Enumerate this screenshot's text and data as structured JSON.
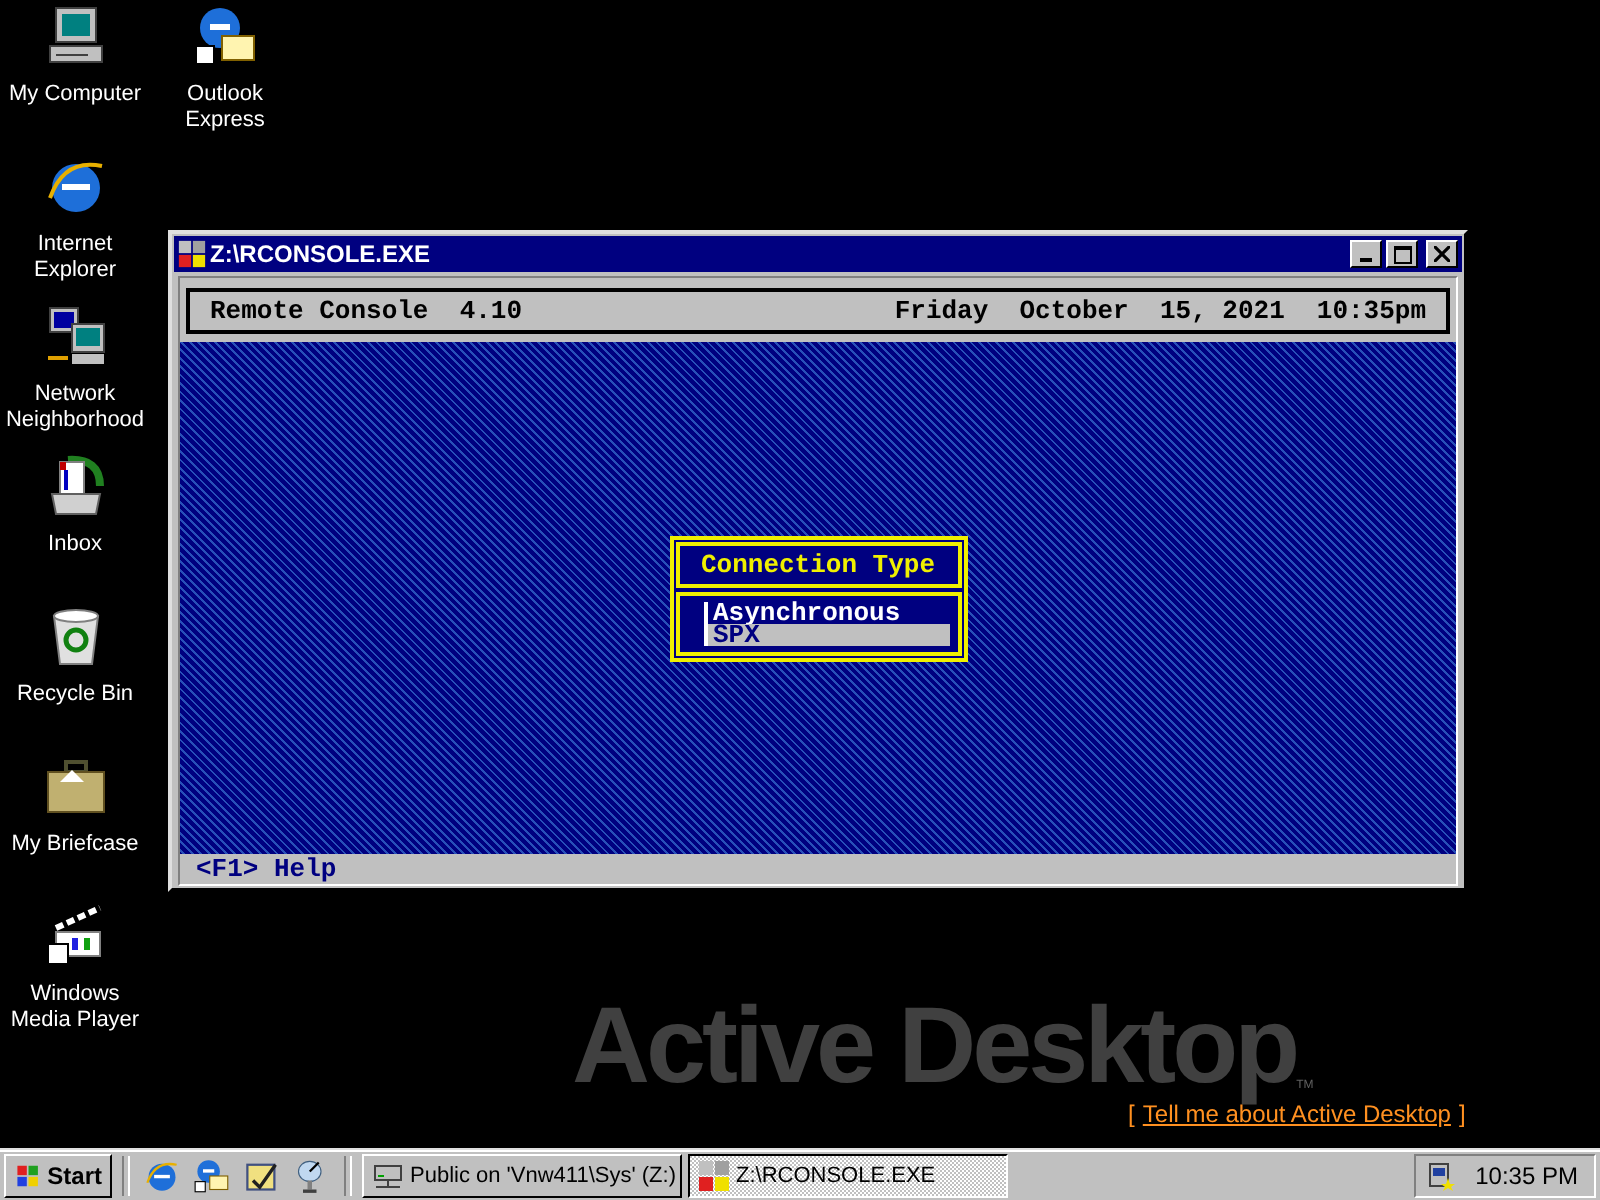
{
  "desktop": {
    "columns": [
      {
        "icons": [
          {
            "kind": "computer",
            "label": "My Computer"
          },
          {
            "kind": "ie",
            "label": "Internet Explorer"
          },
          {
            "kind": "network",
            "label": "Network Neighborhood"
          },
          {
            "kind": "inbox",
            "label": "Inbox"
          },
          {
            "kind": "recycle",
            "label": "Recycle Bin"
          },
          {
            "kind": "briefcase",
            "label": "My Briefcase"
          },
          {
            "kind": "media",
            "label": "Windows Media Player"
          }
        ]
      },
      {
        "icons": [
          {
            "kind": "outlook",
            "label": "Outlook Express"
          }
        ]
      }
    ]
  },
  "window": {
    "title": "Z:\\RCONSOLE.EXE",
    "header": {
      "product": "Remote Console  4.10",
      "date": "Friday  October  15, 2021",
      "time": "10:35pm"
    },
    "dialog": {
      "title": "Connection Type",
      "options": [
        {
          "label": "Asynchronous",
          "selected": false
        },
        {
          "label": "SPX",
          "selected": true
        }
      ]
    },
    "footer": "<F1> Help"
  },
  "active_desktop": {
    "title": "Active Desktop",
    "trademark": "TM",
    "bracket_open": "[",
    "link": "Tell me about Active Desktop",
    "bracket_close": "]"
  },
  "taskbar": {
    "start": "Start",
    "quick_launch": [
      {
        "kind": "ie"
      },
      {
        "kind": "outlook"
      },
      {
        "kind": "desktop"
      },
      {
        "kind": "channels"
      }
    ],
    "tasks": [
      {
        "kind": "drive",
        "label": "Public on 'Vnw411\\Sys' (Z:)",
        "selected": false
      },
      {
        "kind": "dos",
        "label": "Z:\\RCONSOLE.EXE",
        "selected": true
      }
    ],
    "clock": "10:35 PM"
  }
}
